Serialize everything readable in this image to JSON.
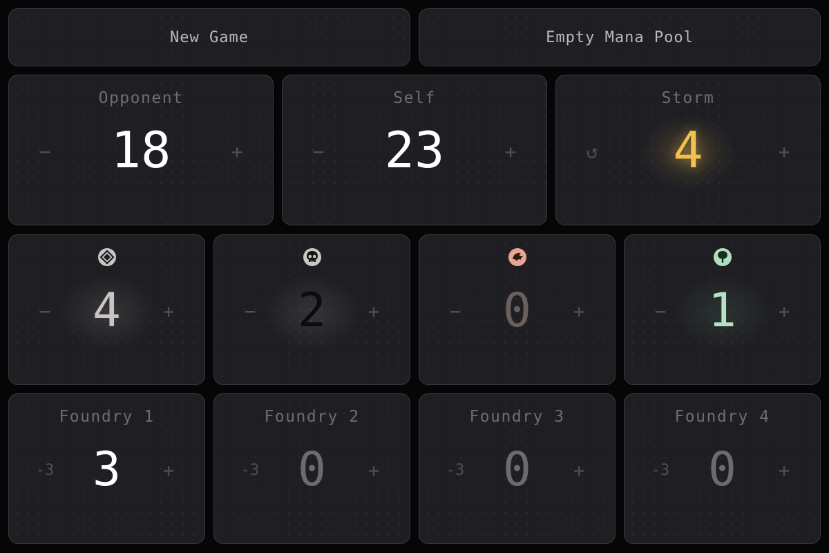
{
  "top": {
    "new_game": "New Game",
    "empty_mana_pool": "Empty Mana Pool"
  },
  "counters": [
    {
      "label": "Opponent",
      "value": "18",
      "minus": "−",
      "plus": "+"
    },
    {
      "label": "Self",
      "value": "23",
      "minus": "−",
      "plus": "+"
    },
    {
      "label": "Storm",
      "value": "4",
      "reset": "↺",
      "plus": "+"
    }
  ],
  "mana": [
    {
      "color": "colorless",
      "icon": "colorless-mana-icon",
      "value": "4",
      "minus": "−",
      "plus": "+",
      "tint": "#c9c5c2"
    },
    {
      "color": "black",
      "icon": "black-mana-skull-icon",
      "value": "2",
      "minus": "−",
      "plus": "+",
      "tint": "#0c0c0d"
    },
    {
      "color": "red",
      "icon": "red-mana-dragon-icon",
      "value": "0",
      "minus": "−",
      "plus": "+",
      "tint": "#6b5f5d"
    },
    {
      "color": "green",
      "icon": "green-mana-tree-icon",
      "value": "1",
      "minus": "−",
      "plus": "+",
      "tint": "#b6e2c3"
    }
  ],
  "foundries": [
    {
      "label": "Foundry 1",
      "value": "3",
      "minus": "-3",
      "plus": "+"
    },
    {
      "label": "Foundry 2",
      "value": "0",
      "minus": "-3",
      "plus": "+"
    },
    {
      "label": "Foundry 3",
      "value": "0",
      "minus": "-3",
      "plus": "+"
    },
    {
      "label": "Foundry 4",
      "value": "0",
      "minus": "-3",
      "plus": "+"
    }
  ],
  "colors": {
    "background": "#060607",
    "card": "#1f1f23",
    "border": "#3a3a3f",
    "storm_accent": "#f2c04f",
    "white_text": "#ffffff",
    "muted": "#6d6d72"
  }
}
